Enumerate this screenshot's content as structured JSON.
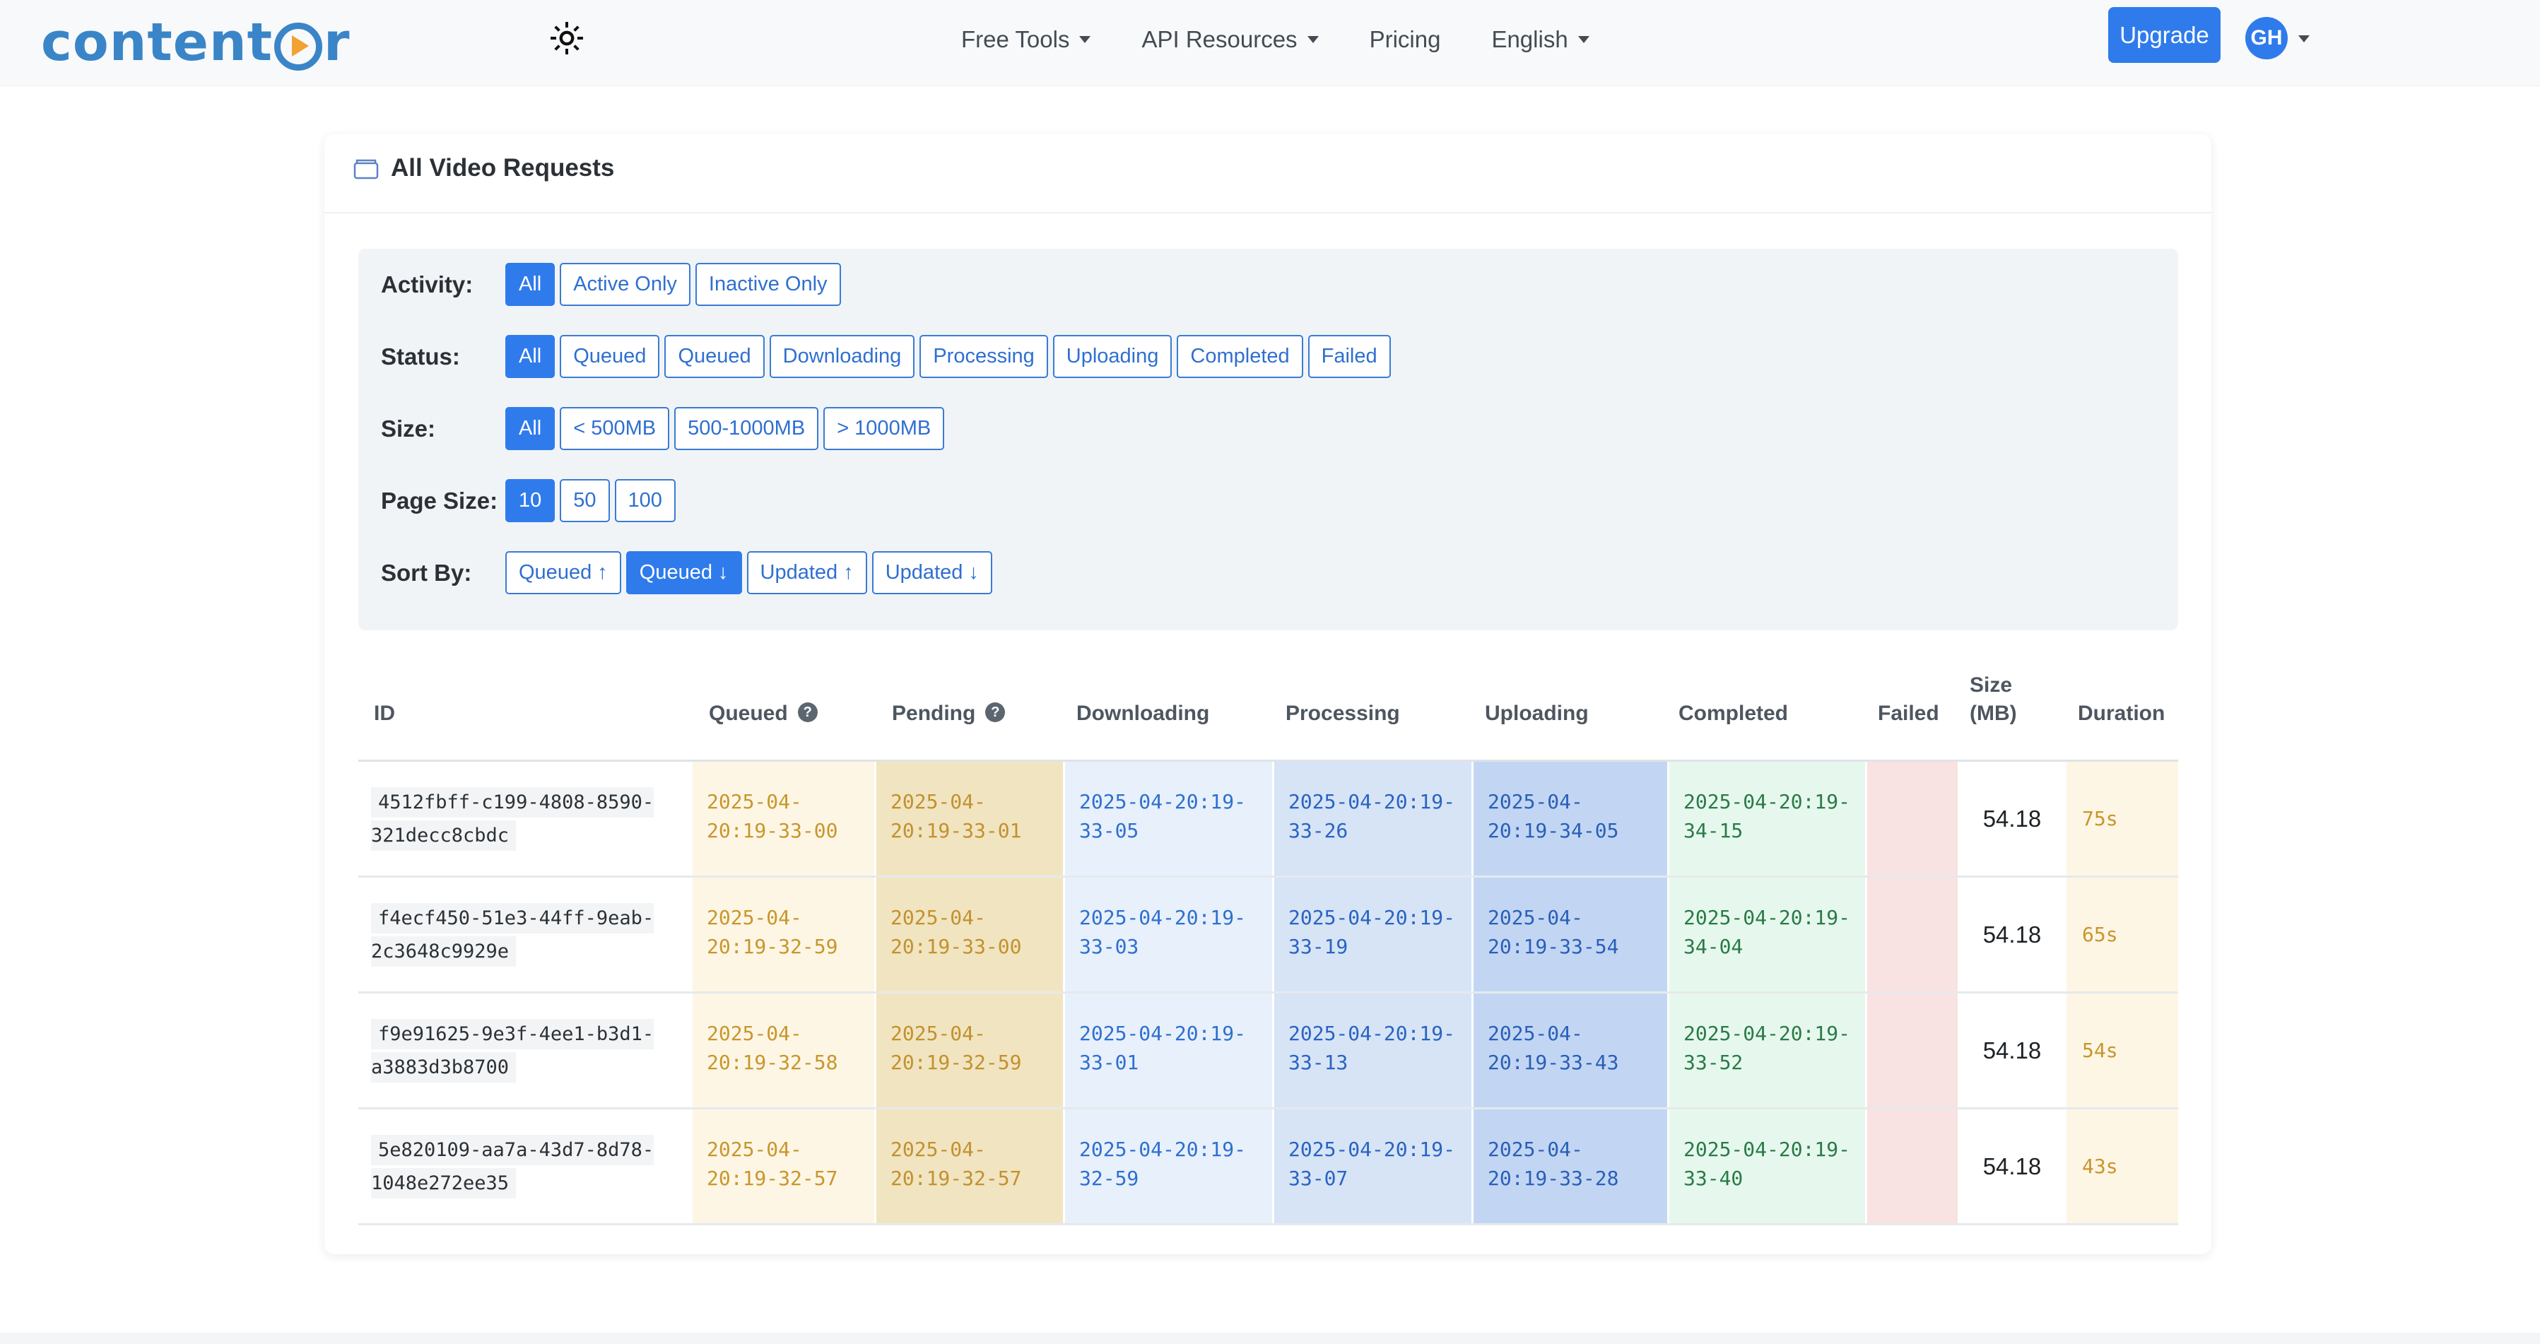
{
  "nav": {
    "brand": "contentor",
    "links": [
      {
        "label": "Free Tools",
        "dropdown": true
      },
      {
        "label": "API Resources",
        "dropdown": true
      },
      {
        "label": "Pricing",
        "dropdown": false
      },
      {
        "label": "English",
        "dropdown": true
      }
    ],
    "upgrade_label": "Upgrade",
    "avatar_initials": "GH"
  },
  "page": {
    "title": "All Video Requests"
  },
  "filters": {
    "activity": {
      "label": "Activity:",
      "options": [
        "All",
        "Active Only",
        "Inactive Only"
      ],
      "active": 0
    },
    "status": {
      "label": "Status:",
      "options": [
        "All",
        "Queued",
        "Queued",
        "Downloading",
        "Processing",
        "Uploading",
        "Completed",
        "Failed"
      ],
      "active": 0
    },
    "size": {
      "label": "Size:",
      "options": [
        "All",
        "< 500MB",
        "500-1000MB",
        "> 1000MB"
      ],
      "active": 0
    },
    "page_size": {
      "label": "Page Size:",
      "options": [
        "10",
        "50",
        "100"
      ],
      "active": 0
    },
    "sort_by": {
      "label": "Sort By:",
      "options": [
        "Queued ↑",
        "Queued ↓",
        "Updated ↑",
        "Updated ↓"
      ],
      "active": 1
    }
  },
  "table": {
    "headers": {
      "id": "ID",
      "queued": "Queued",
      "pending": "Pending",
      "downloading": "Downloading",
      "processing": "Processing",
      "uploading": "Uploading",
      "completed": "Completed",
      "failed": "Failed",
      "size": "Size (MB)",
      "duration": "Duration"
    },
    "rows": [
      {
        "id": "4512fbff-c199-4808-8590-321decc8cbdc",
        "queued": "2025-04-20:19-33-00",
        "pending": "2025-04-20:19-33-01",
        "downloading": "2025-04-20:19-33-05",
        "processing": "2025-04-20:19-33-26",
        "uploading": "2025-04-20:19-34-05",
        "completed": "2025-04-20:19-34-15",
        "failed": "",
        "size": "54.18",
        "duration": "75s"
      },
      {
        "id": "f4ecf450-51e3-44ff-9eab-2c3648c9929e",
        "queued": "2025-04-20:19-32-59",
        "pending": "2025-04-20:19-33-00",
        "downloading": "2025-04-20:19-33-03",
        "processing": "2025-04-20:19-33-19",
        "uploading": "2025-04-20:19-33-54",
        "completed": "2025-04-20:19-34-04",
        "failed": "",
        "size": "54.18",
        "duration": "65s"
      },
      {
        "id": "f9e91625-9e3f-4ee1-b3d1-a3883d3b8700",
        "queued": "2025-04-20:19-32-58",
        "pending": "2025-04-20:19-32-59",
        "downloading": "2025-04-20:19-33-01",
        "processing": "2025-04-20:19-33-13",
        "uploading": "2025-04-20:19-33-43",
        "completed": "2025-04-20:19-33-52",
        "failed": "",
        "size": "54.18",
        "duration": "54s"
      },
      {
        "id": "5e820109-aa7a-43d7-8d78-1048e272ee35",
        "queued": "2025-04-20:19-32-57",
        "pending": "2025-04-20:19-32-57",
        "downloading": "2025-04-20:19-32-59",
        "processing": "2025-04-20:19-33-07",
        "uploading": "2025-04-20:19-33-28",
        "completed": "2025-04-20:19-33-40",
        "failed": "",
        "size": "54.18",
        "duration": "43s"
      }
    ]
  },
  "colors": {
    "accent": "#2f7bec",
    "brand": "#3a85c8",
    "brand_play": "#f2a132"
  }
}
